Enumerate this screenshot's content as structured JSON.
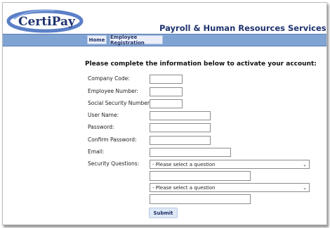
{
  "header": {
    "logo_text": "CertiPay",
    "title": "Payroll & Human Resources Services"
  },
  "nav": {
    "home": "Home",
    "employee_registration": "Employee Registration"
  },
  "form": {
    "intro": "Please complete the information below to activate your account:",
    "labels": {
      "company_code": "Company Code:",
      "employee_number": "Employee Number:",
      "ssn": "Social Security Number:",
      "username": "User Name:",
      "password": "Password:",
      "confirm_password": "Confirm Password:",
      "email": "Email:",
      "security_questions": "Security Questions:"
    },
    "security_question_1": {
      "selected": "- Please select a question"
    },
    "security_question_2": {
      "selected": "- Please select a question"
    },
    "submit_label": "Submit"
  },
  "colors": {
    "brand_navy": "#20336f",
    "nav_bar": "#7fa3d2",
    "logo_arc": "#5b7fc7"
  }
}
